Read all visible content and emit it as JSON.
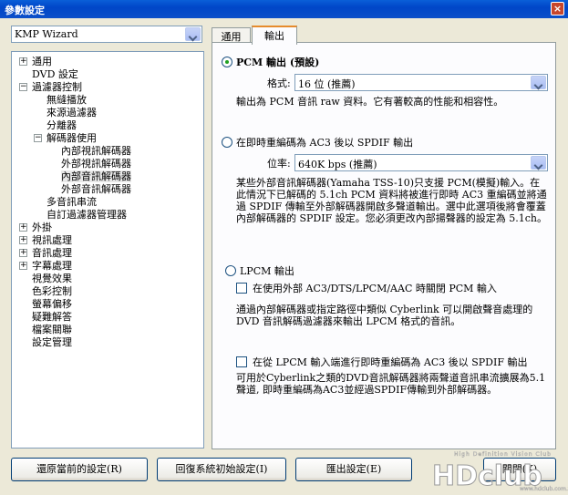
{
  "window": {
    "title": "參數設定",
    "close_label": "×"
  },
  "preset": {
    "value": "KMP Wizard"
  },
  "tree": {
    "items": [
      {
        "label": "通用",
        "expander": "+"
      },
      {
        "label": "DVD 設定",
        "expander": ""
      },
      {
        "label": "過濾器控制",
        "expander": "−"
      },
      {
        "label": "無縫播放",
        "expander": ""
      },
      {
        "label": "來源過濾器",
        "expander": ""
      },
      {
        "label": "分離器",
        "expander": ""
      },
      {
        "label": "解碼器使用",
        "expander": "−"
      },
      {
        "label": "內部視訊解碼器",
        "expander": ""
      },
      {
        "label": "外部視訊解碼器",
        "expander": ""
      },
      {
        "label": "內部音訊解碼器",
        "expander": ""
      },
      {
        "label": "外部音訊解碼器",
        "expander": ""
      },
      {
        "label": "多音訊串流",
        "expander": ""
      },
      {
        "label": "自訂過濾器管理器",
        "expander": ""
      },
      {
        "label": "外掛",
        "expander": "+"
      },
      {
        "label": "視訊處理",
        "expander": "+"
      },
      {
        "label": "音訊處理",
        "expander": "+"
      },
      {
        "label": "字幕處理",
        "expander": "+"
      },
      {
        "label": "視覺效果",
        "expander": ""
      },
      {
        "label": "色彩控制",
        "expander": ""
      },
      {
        "label": "螢幕偏移",
        "expander": ""
      },
      {
        "label": "疑難解答",
        "expander": ""
      },
      {
        "label": "檔案關聯",
        "expander": ""
      },
      {
        "label": "設定管理",
        "expander": ""
      }
    ]
  },
  "tabs": [
    {
      "label": "通用"
    },
    {
      "label": "輸出"
    }
  ],
  "pcm": {
    "radio_label": "PCM 輸出 (預設)",
    "format_label": "格式:",
    "format_value": "16 位 (推薦)",
    "desc": "輸出為 PCM 音訊 raw 資料。它有著較高的性能和相容性。"
  },
  "ac3": {
    "radio_label": "在即時重編碼為 AC3 後以 SPDIF 輸出",
    "rate_label": "位率:",
    "rate_value": "640K bps (推薦)",
    "desc": "某些外部音訊解碼器(Yamaha TSS-10)只支援 PCM(模擬)輸入。在此情況下已解碼的 5.1ch PCM 資料將被進行即時 AC3 重編碼並將通過 SPDIF 傳輸至外部解碼器開啟多聲道輸出。選中此選項後將會覆蓋內部解碼器的 SPDIF 設定。您必須更改內部揚聲器的設定為 5.1ch。"
  },
  "lpcm": {
    "radio_label": "LPCM 輸出",
    "check1_label": "在使用外部 AC3/DTS/LPCM/AAC 時關閉 PCM 輸入",
    "desc1": "通過內部解碼器或指定路徑中類似 Cyberlink 可以開啟聲音處理的 DVD 音訊解碼過濾器來輸出 LPCM 格式的音訊。",
    "check2_label": "在從 LPCM 輸入端進行即時重編碼為 AC3 後以 SPDIF 輸出",
    "desc2": "可用於Cyberlink之類的DVD音訊解碼器將兩聲道音訊串流擴展為5.1聲道, 即時重編碼為AC3並經過SPDIF傳輸到外部解碼器。"
  },
  "buttons": {
    "restore": "還原當前的設定(R)",
    "reset": "回復系統初始設定(I)",
    "export": "匯出設定(E)",
    "close": "關閉(X)"
  },
  "watermark": {
    "tagline": "High Definition Vision Club",
    "brand": "HDclub",
    "url": "www.hdclub.com.tw"
  },
  "colors": {
    "title_bar": "#0046c8",
    "dialog_bg": "#ece9d8",
    "selected_radio": "#21a121"
  }
}
